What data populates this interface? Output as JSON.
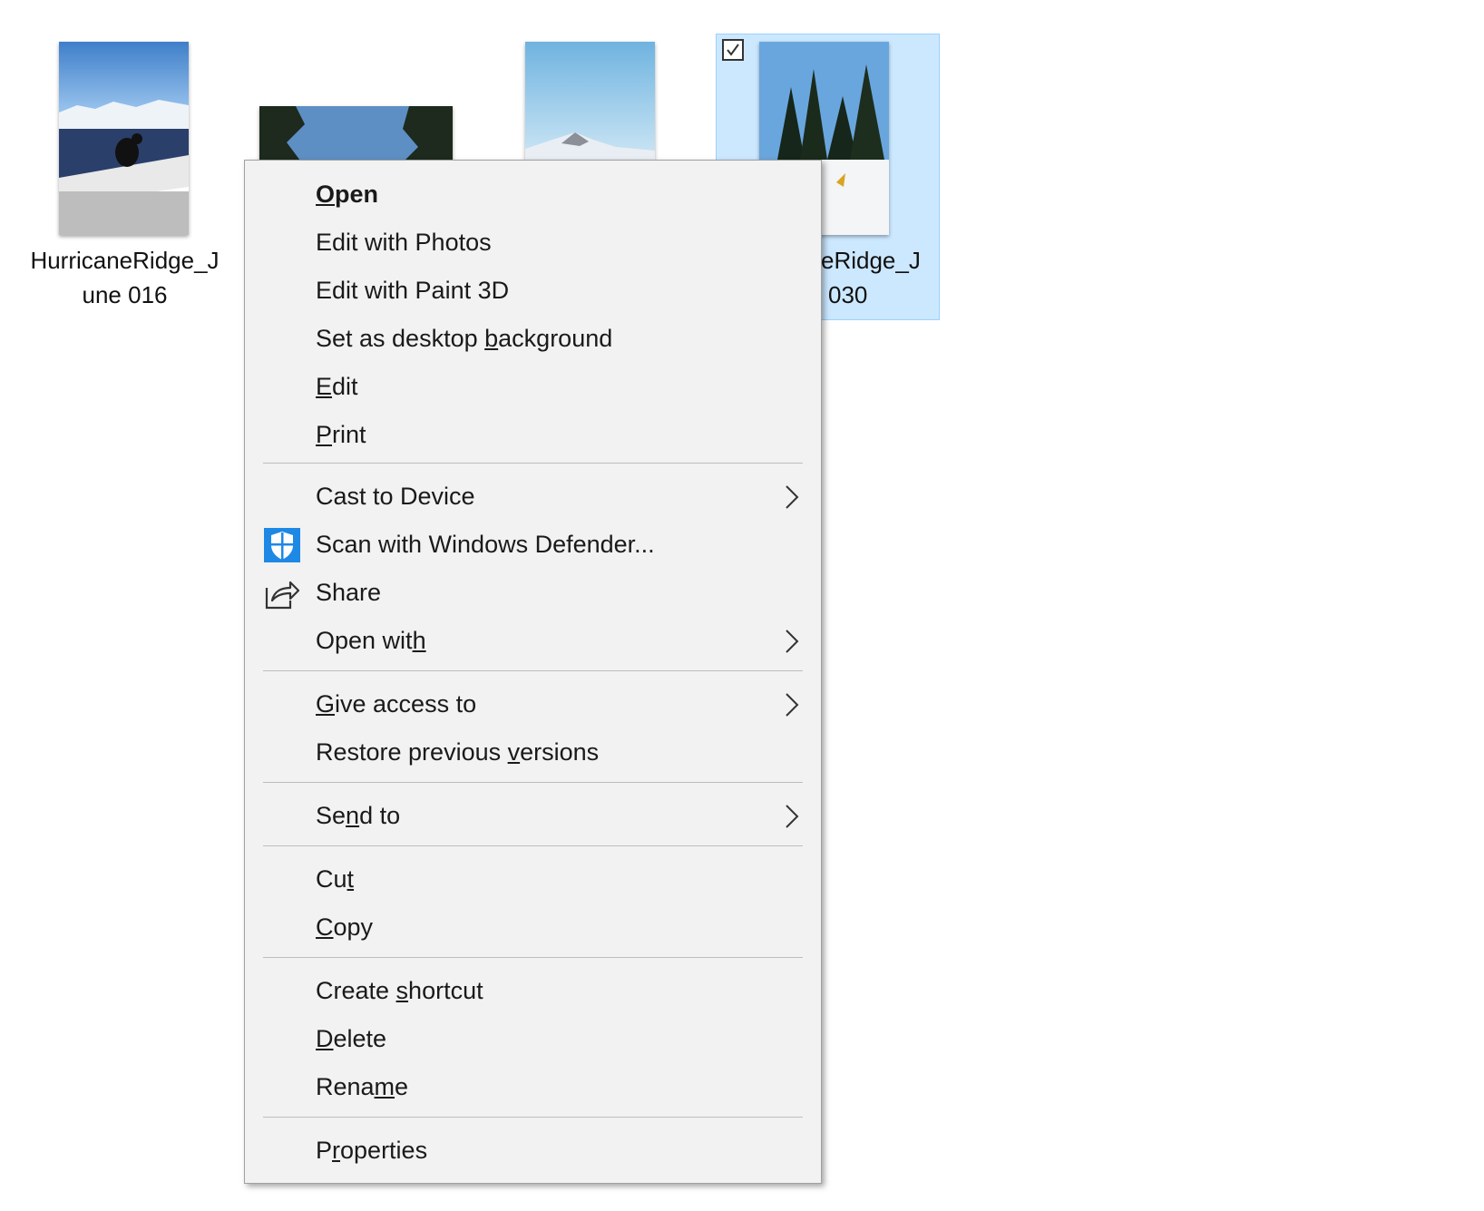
{
  "files": [
    {
      "label_line1": "HurricaneRidge_J",
      "label_line2": "une 016"
    },
    {
      "label_line1": "",
      "label_line2": ""
    },
    {
      "label_line1": "",
      "label_line2": ""
    },
    {
      "label_line1": "eRidge_J",
      "label_line2": "030",
      "selected": true
    }
  ],
  "context_menu": {
    "open": {
      "pre": "",
      "u": "O",
      "post": "pen"
    },
    "edit_photos": {
      "pre": "Edit with Photos",
      "u": "",
      "post": ""
    },
    "edit_paint3d": {
      "pre": "Edit with Paint 3D",
      "u": "",
      "post": ""
    },
    "set_desktop": {
      "pre": "Set as desktop ",
      "u": "b",
      "post": "ackground"
    },
    "edit": {
      "pre": "",
      "u": "E",
      "post": "dit"
    },
    "print": {
      "pre": "",
      "u": "P",
      "post": "rint"
    },
    "cast": {
      "pre": "Cast to Device",
      "u": "",
      "post": ""
    },
    "scan": {
      "pre": "Scan with Windows Defender...",
      "u": "",
      "post": ""
    },
    "share": {
      "pre": "Share",
      "u": "",
      "post": ""
    },
    "open_with": {
      "pre": "Open wit",
      "u": "h",
      "post": ""
    },
    "give_access": {
      "pre": "",
      "u": "G",
      "post": "ive access to"
    },
    "restore": {
      "pre": "Restore previous ",
      "u": "v",
      "post": "ersions"
    },
    "send_to": {
      "pre": "Se",
      "u": "n",
      "post": "d to"
    },
    "cut": {
      "pre": "Cu",
      "u": "t",
      "post": ""
    },
    "copy": {
      "pre": "",
      "u": "C",
      "post": "opy"
    },
    "create_shortcut": {
      "pre": "Create ",
      "u": "s",
      "post": "hortcut"
    },
    "delete": {
      "pre": "",
      "u": "D",
      "post": "elete"
    },
    "rename": {
      "pre": "Rena",
      "u": "m",
      "post": "e"
    },
    "properties": {
      "pre": "P",
      "u": "r",
      "post": "operties"
    }
  },
  "icons": {
    "shield": "windows-defender-shield-icon",
    "share": "share-icon",
    "chevron": "chevron-right-icon",
    "checkbox": "checkmark-icon"
  },
  "colors": {
    "menu_bg": "#f2f2f2",
    "selection_bg": "#cce8ff",
    "selection_border": "#99d1ff",
    "defender_blue": "#1e88e5"
  }
}
